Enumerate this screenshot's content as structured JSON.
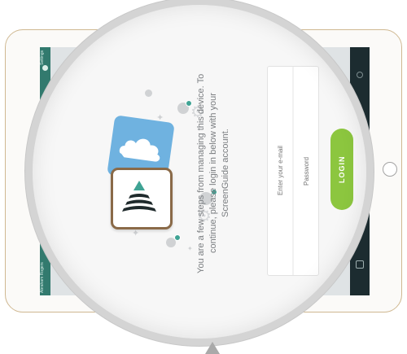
{
  "device": {
    "sidebar_title": "Settings",
    "sidebar_user": "Abraham Rogers"
  },
  "intro": {
    "message": "You are a few steps from managing this device. To continue, please login in below with your ScreenGuide account."
  },
  "login": {
    "email_placeholder": "Enter your e-mail",
    "password_placeholder": "Password",
    "button_label": "LOGIN"
  },
  "colors": {
    "accent_green": "#8cc63f",
    "sidebar_teal": "#327a6e",
    "app_icon_border": "#8a6a48",
    "card_blue": "#6fb2e0"
  },
  "icons": [
    "gear-icon",
    "app-logo-icon",
    "cloud-icon",
    "sparkle-icon"
  ]
}
